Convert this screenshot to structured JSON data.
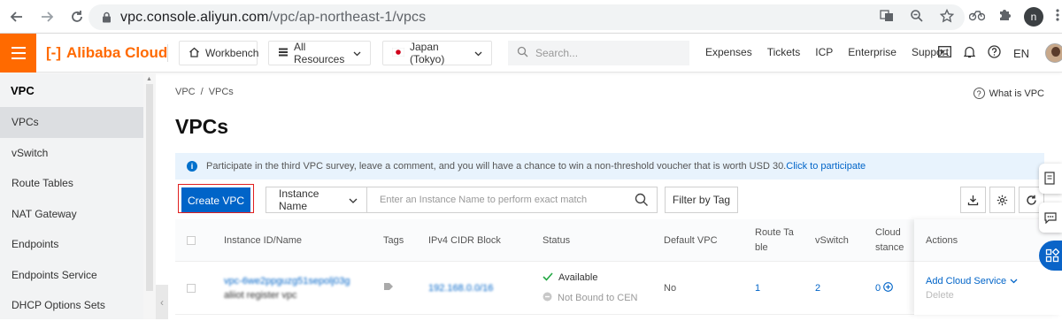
{
  "browser": {
    "url_host": "vpc.console.aliyun.com",
    "url_path": "/vpc/ap-northeast-1/vpcs",
    "profile_initial": "n"
  },
  "topbar": {
    "brand": "Alibaba Cloud",
    "brand_mark": "[-]",
    "workbench": "Workbench",
    "all_resources": "All Resources",
    "region": "Japan (Tokyo)",
    "search_placeholder": "Search...",
    "links": [
      "Expenses",
      "Tickets",
      "ICP",
      "Enterprise",
      "Support"
    ],
    "lang": "EN",
    "accent": "#ff6a00"
  },
  "sidebar": {
    "title": "VPC",
    "items": [
      {
        "label": "VPCs",
        "active": true
      },
      {
        "label": "vSwitch",
        "active": false
      },
      {
        "label": "Route Tables",
        "active": false
      },
      {
        "label": "NAT Gateway",
        "active": false
      },
      {
        "label": "Endpoints",
        "active": false
      },
      {
        "label": "Endpoints Service",
        "active": false
      },
      {
        "label": "DHCP Options Sets",
        "active": false
      }
    ]
  },
  "main": {
    "breadcrumb": [
      "VPC",
      "/",
      "VPCs"
    ],
    "what_is": "What is VPC",
    "title": "VPCs",
    "notice_text": "Participate in the third VPC survey, leave a comment, and you will have a chance to win a non-threshold voucher that is worth USD 30.",
    "notice_link": "Click to participate",
    "create_button": "Create VPC",
    "filter_field": "Instance Name",
    "filter_placeholder": "Enter an Instance Name to perform exact match",
    "filter_by_tag": "Filter by Tag",
    "primary_color": "#0064c8"
  },
  "table": {
    "headers": {
      "id": "Instance ID/Name",
      "tags": "Tags",
      "cidr": "IPv4 CIDR Block",
      "status": "Status",
      "default_vpc": "Default VPC",
      "route_table_1": "Route Ta",
      "route_table_2": "ble",
      "vswitch": "vSwitch",
      "cloud_1": "Cloud",
      "cloud_2": "stance",
      "actions": "Actions"
    },
    "rows": [
      {
        "id": "vpc-6we2ppguzg51sepolj03g",
        "name": "aliiot register vpc",
        "cidr": "192.168.0.0/16",
        "status": "Available",
        "cen_status": "Not Bound to CEN",
        "default_vpc": "No",
        "route_tables": "1",
        "vswitches": "2",
        "cloud": "0",
        "action_add": "Add Cloud Service",
        "action_delete": "Delete"
      }
    ]
  }
}
